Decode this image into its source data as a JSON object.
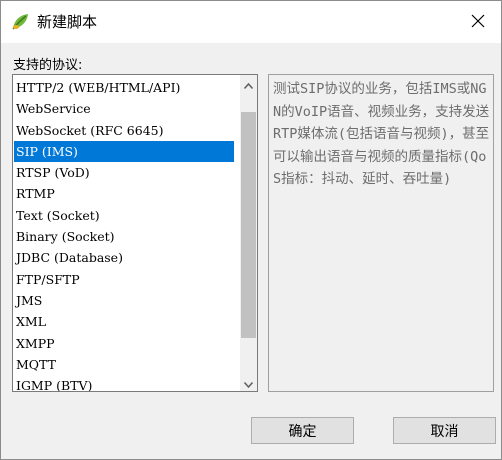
{
  "window": {
    "title": "新建脚本",
    "close_icon": "close-icon",
    "app_icon": "leaf-icon"
  },
  "protocol_label": "支持的协议:",
  "protocols": [
    "HTTP/2 (WEB/HTML/API)",
    "WebService",
    "WebSocket (RFC 6645)",
    "SIP (IMS)",
    "RTSP (VoD)",
    "RTMP",
    "Text (Socket)",
    "Binary (Socket)",
    "JDBC (Database)",
    "FTP/SFTP",
    "JMS",
    "XML",
    "XMPP",
    "MQTT",
    "IGMP (BTV)"
  ],
  "selected_protocol": "SIP (IMS)",
  "description": "测试SIP协议的业务，包括IMS或NGN的VoIP语音、视频业务，支持发送RTP媒体流(包括语音与视频)，甚至可以输出语音与视频的质量指标(QoS指标：抖动、延时、吞吐量)",
  "buttons": {
    "ok": "确定",
    "cancel": "取消"
  },
  "colors": {
    "selection": "#0078d7",
    "dialog_bg": "#f0f0f0",
    "description_text": "#6d6d6d"
  }
}
